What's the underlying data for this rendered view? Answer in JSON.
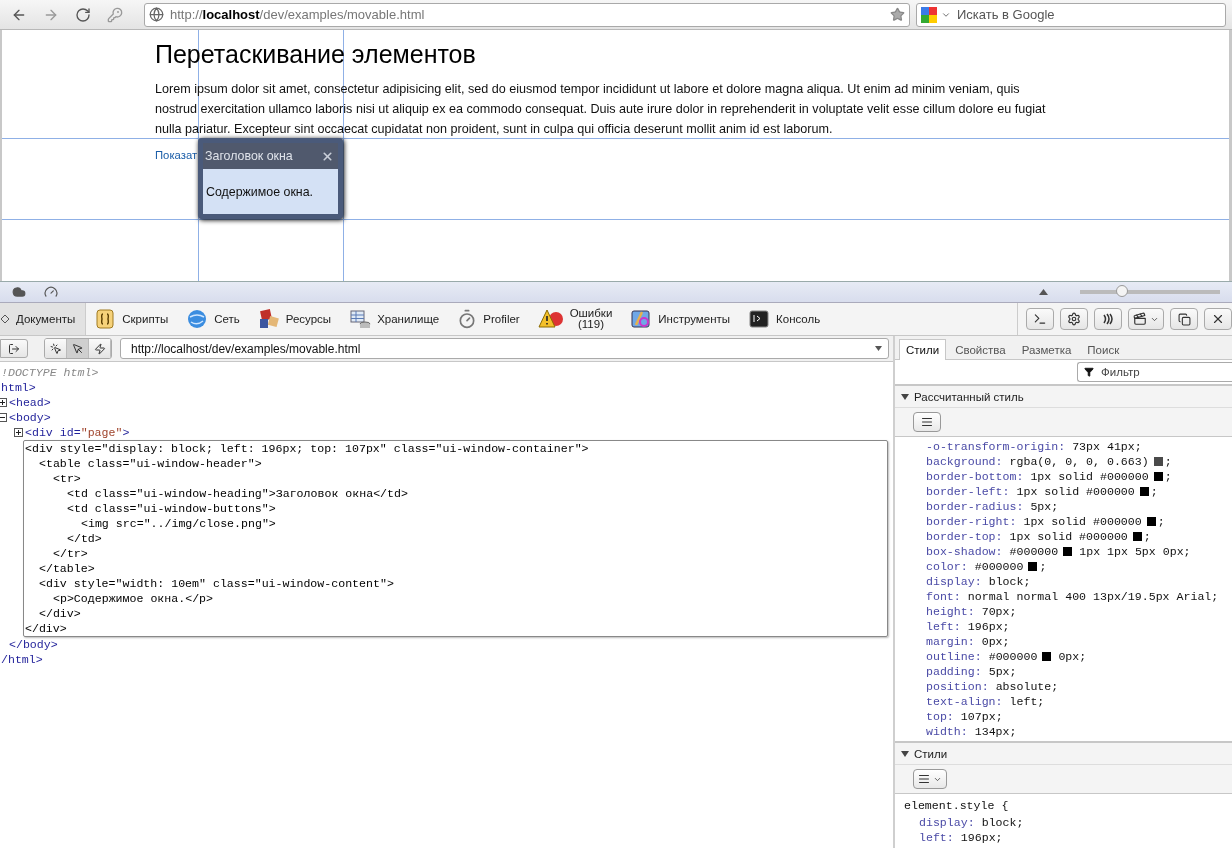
{
  "browser": {
    "url": "http://**localhost**/dev/examples/movable.html",
    "search_placeholder": "Искать в Google"
  },
  "page": {
    "heading": "Перетаскивание элементов",
    "paragraph": "Lorem ipsum dolor sit amet, consectetur adipisicing elit, sed do eiusmod tempor incididunt ut labore et dolore magna aliqua. Ut enim ad minim veniam, quis nostrud exercitation ullamco laboris nisi ut aliquip ex ea commodo consequat. Duis aute irure dolor in reprehenderit in voluptate velit esse cillum dolore eu fugiat nulla pariatur. Excepteur sint occaecat cupidatat non proident, sunt in culpa qui officia deserunt mollit anim id est laborum.",
    "link": "Показат",
    "popup": {
      "title": "Заголовок окна",
      "content": "Содержимое окна."
    }
  },
  "devtools": {
    "zoom": {
      "level": 0.3
    },
    "tabs": [
      {
        "label": "Документы",
        "selected": true
      },
      {
        "label": "Скрипты",
        "selected": false
      },
      {
        "label": "Сеть",
        "selected": false
      },
      {
        "label": "Ресурсы",
        "selected": false
      },
      {
        "label": "Хранилище",
        "selected": false
      },
      {
        "label": "Profiler",
        "selected": false
      },
      {
        "label": "Ошибки",
        "count": "(119)",
        "selected": false
      },
      {
        "label": "Инструменты",
        "selected": false
      },
      {
        "label": "Консоль",
        "selected": false
      }
    ],
    "tools": [
      {
        "selected": false
      },
      {
        "selected": true
      },
      {
        "selected": false
      }
    ],
    "document_url": "http://localhost/dev/examples/movable.html",
    "tree": [
      {
        "kind": "doctype",
        "text": "!DOCTYPE html>"
      },
      {
        "kind": "element",
        "text": "html>",
        "close": "/html>",
        "children": [
          {
            "kind": "element",
            "text": "<head>",
            "expanded": false
          },
          {
            "kind": "element",
            "text": "<body>",
            "expanded": true,
            "close": "</body>",
            "children": [
              {
                "kind": "element",
                "text": "<div id=\"page\">",
                "expanded": false
              },
              {
                "kind": "element",
                "selected": true,
                "text": "<div style=\"display: block; left: 196px; top: 107px\" class=\"ui-window-container\">",
                "close": "</div>",
                "children": [
                  {
                    "kind": "element",
                    "text": "<table class=\"ui-window-header\">",
                    "close": "</table>",
                    "children": [
                      {
                        "kind": "element",
                        "text": "<tr>",
                        "close": "</tr>",
                        "children": [
                          {
                            "kind": "element",
                            "text": "<td class=\"ui-window-heading\">Заголовок окна</td>"
                          },
                          {
                            "kind": "element",
                            "text": "<td class=\"ui-window-buttons\">",
                            "close": "</td>",
                            "children": [
                              {
                                "kind": "element",
                                "text": "<img src=\"../img/close.png\">"
                              }
                            ]
                          }
                        ]
                      }
                    ]
                  },
                  {
                    "kind": "element",
                    "text": "<div style=\"width: 10em\" class=\"ui-window-content\">",
                    "close": "</div>",
                    "children": [
                      {
                        "kind": "element",
                        "text": "<p>Содержимое окна.</p>"
                      }
                    ]
                  }
                ]
              }
            ]
          }
        ]
      }
    ],
    "side_tabs": [
      {
        "label": "Стили",
        "selected": true
      },
      {
        "label": "Свойства",
        "selected": false
      },
      {
        "label": "Разметка",
        "selected": false
      },
      {
        "label": "Поиск",
        "selected": false
      }
    ],
    "filter_placeholder": "Фильтр",
    "computed": {
      "title": "Рассчитанный стиль",
      "expanded": true,
      "props": [
        {
          "name": "-o-transform-origin:",
          "value": "73px 41px;"
        },
        {
          "name": "background:",
          "value": "rgba(0, 0, 0, 0.663)",
          "color": "#4a4a4a",
          "rest": ";"
        },
        {
          "name": "border-bottom:",
          "value": "1px solid #000000",
          "color": "#000000",
          "rest": ";"
        },
        {
          "name": "border-left:",
          "value": "1px solid #000000",
          "color": "#000000",
          "rest": ";"
        },
        {
          "name": "border-radius:",
          "value": "5px;"
        },
        {
          "name": "border-right:",
          "value": "1px solid #000000",
          "color": "#000000",
          "rest": ";"
        },
        {
          "name": "border-top:",
          "value": "1px solid #000000",
          "color": "#000000",
          "rest": ";"
        },
        {
          "name": "box-shadow:",
          "value": "#000000",
          "color": "#000000",
          "rest": "1px 1px 5px 0px;"
        },
        {
          "name": "color:",
          "value": "#000000",
          "color": "#000000",
          "rest": ";"
        },
        {
          "name": "display:",
          "value": "block;"
        },
        {
          "name": "font:",
          "value": "normal normal 400 13px/19.5px Arial;"
        },
        {
          "name": "height:",
          "value": "70px;"
        },
        {
          "name": "left:",
          "value": "196px;"
        },
        {
          "name": "margin:",
          "value": "0px;"
        },
        {
          "name": "outline:",
          "value": "#000000",
          "color": "#000000",
          "rest": "0px;"
        },
        {
          "name": "padding:",
          "value": "5px;"
        },
        {
          "name": "position:",
          "value": "absolute;"
        },
        {
          "name": "text-align:",
          "value": "left;"
        },
        {
          "name": "top:",
          "value": "107px;"
        },
        {
          "name": "width:",
          "value": "134px;"
        }
      ]
    },
    "styles": {
      "title": "Стили",
      "expanded": true,
      "selector": "element.style {",
      "props": [
        {
          "name": "display:",
          "value": "block;"
        },
        {
          "name": "left:",
          "value": "196px;"
        }
      ]
    }
  }
}
